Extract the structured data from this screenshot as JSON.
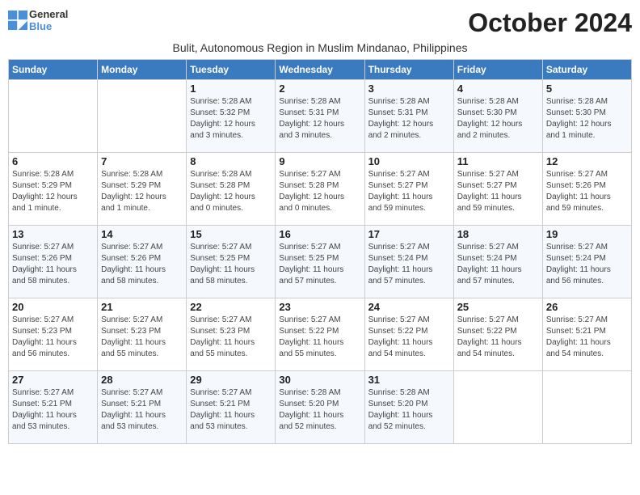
{
  "header": {
    "logo_general": "General",
    "logo_blue": "Blue",
    "month_title": "October 2024",
    "subtitle": "Bulit, Autonomous Region in Muslim Mindanao, Philippines"
  },
  "weekdays": [
    "Sunday",
    "Monday",
    "Tuesday",
    "Wednesday",
    "Thursday",
    "Friday",
    "Saturday"
  ],
  "weeks": [
    [
      {
        "day": "",
        "info": ""
      },
      {
        "day": "",
        "info": ""
      },
      {
        "day": "1",
        "info": "Sunrise: 5:28 AM\nSunset: 5:32 PM\nDaylight: 12 hours\nand 3 minutes."
      },
      {
        "day": "2",
        "info": "Sunrise: 5:28 AM\nSunset: 5:31 PM\nDaylight: 12 hours\nand 3 minutes."
      },
      {
        "day": "3",
        "info": "Sunrise: 5:28 AM\nSunset: 5:31 PM\nDaylight: 12 hours\nand 2 minutes."
      },
      {
        "day": "4",
        "info": "Sunrise: 5:28 AM\nSunset: 5:30 PM\nDaylight: 12 hours\nand 2 minutes."
      },
      {
        "day": "5",
        "info": "Sunrise: 5:28 AM\nSunset: 5:30 PM\nDaylight: 12 hours\nand 1 minute."
      }
    ],
    [
      {
        "day": "6",
        "info": "Sunrise: 5:28 AM\nSunset: 5:29 PM\nDaylight: 12 hours\nand 1 minute."
      },
      {
        "day": "7",
        "info": "Sunrise: 5:28 AM\nSunset: 5:29 PM\nDaylight: 12 hours\nand 1 minute."
      },
      {
        "day": "8",
        "info": "Sunrise: 5:28 AM\nSunset: 5:28 PM\nDaylight: 12 hours\nand 0 minutes."
      },
      {
        "day": "9",
        "info": "Sunrise: 5:27 AM\nSunset: 5:28 PM\nDaylight: 12 hours\nand 0 minutes."
      },
      {
        "day": "10",
        "info": "Sunrise: 5:27 AM\nSunset: 5:27 PM\nDaylight: 11 hours\nand 59 minutes."
      },
      {
        "day": "11",
        "info": "Sunrise: 5:27 AM\nSunset: 5:27 PM\nDaylight: 11 hours\nand 59 minutes."
      },
      {
        "day": "12",
        "info": "Sunrise: 5:27 AM\nSunset: 5:26 PM\nDaylight: 11 hours\nand 59 minutes."
      }
    ],
    [
      {
        "day": "13",
        "info": "Sunrise: 5:27 AM\nSunset: 5:26 PM\nDaylight: 11 hours\nand 58 minutes."
      },
      {
        "day": "14",
        "info": "Sunrise: 5:27 AM\nSunset: 5:26 PM\nDaylight: 11 hours\nand 58 minutes."
      },
      {
        "day": "15",
        "info": "Sunrise: 5:27 AM\nSunset: 5:25 PM\nDaylight: 11 hours\nand 58 minutes."
      },
      {
        "day": "16",
        "info": "Sunrise: 5:27 AM\nSunset: 5:25 PM\nDaylight: 11 hours\nand 57 minutes."
      },
      {
        "day": "17",
        "info": "Sunrise: 5:27 AM\nSunset: 5:24 PM\nDaylight: 11 hours\nand 57 minutes."
      },
      {
        "day": "18",
        "info": "Sunrise: 5:27 AM\nSunset: 5:24 PM\nDaylight: 11 hours\nand 57 minutes."
      },
      {
        "day": "19",
        "info": "Sunrise: 5:27 AM\nSunset: 5:24 PM\nDaylight: 11 hours\nand 56 minutes."
      }
    ],
    [
      {
        "day": "20",
        "info": "Sunrise: 5:27 AM\nSunset: 5:23 PM\nDaylight: 11 hours\nand 56 minutes."
      },
      {
        "day": "21",
        "info": "Sunrise: 5:27 AM\nSunset: 5:23 PM\nDaylight: 11 hours\nand 55 minutes."
      },
      {
        "day": "22",
        "info": "Sunrise: 5:27 AM\nSunset: 5:23 PM\nDaylight: 11 hours\nand 55 minutes."
      },
      {
        "day": "23",
        "info": "Sunrise: 5:27 AM\nSunset: 5:22 PM\nDaylight: 11 hours\nand 55 minutes."
      },
      {
        "day": "24",
        "info": "Sunrise: 5:27 AM\nSunset: 5:22 PM\nDaylight: 11 hours\nand 54 minutes."
      },
      {
        "day": "25",
        "info": "Sunrise: 5:27 AM\nSunset: 5:22 PM\nDaylight: 11 hours\nand 54 minutes."
      },
      {
        "day": "26",
        "info": "Sunrise: 5:27 AM\nSunset: 5:21 PM\nDaylight: 11 hours\nand 54 minutes."
      }
    ],
    [
      {
        "day": "27",
        "info": "Sunrise: 5:27 AM\nSunset: 5:21 PM\nDaylight: 11 hours\nand 53 minutes."
      },
      {
        "day": "28",
        "info": "Sunrise: 5:27 AM\nSunset: 5:21 PM\nDaylight: 11 hours\nand 53 minutes."
      },
      {
        "day": "29",
        "info": "Sunrise: 5:27 AM\nSunset: 5:21 PM\nDaylight: 11 hours\nand 53 minutes."
      },
      {
        "day": "30",
        "info": "Sunrise: 5:28 AM\nSunset: 5:20 PM\nDaylight: 11 hours\nand 52 minutes."
      },
      {
        "day": "31",
        "info": "Sunrise: 5:28 AM\nSunset: 5:20 PM\nDaylight: 11 hours\nand 52 minutes."
      },
      {
        "day": "",
        "info": ""
      },
      {
        "day": "",
        "info": ""
      }
    ]
  ]
}
